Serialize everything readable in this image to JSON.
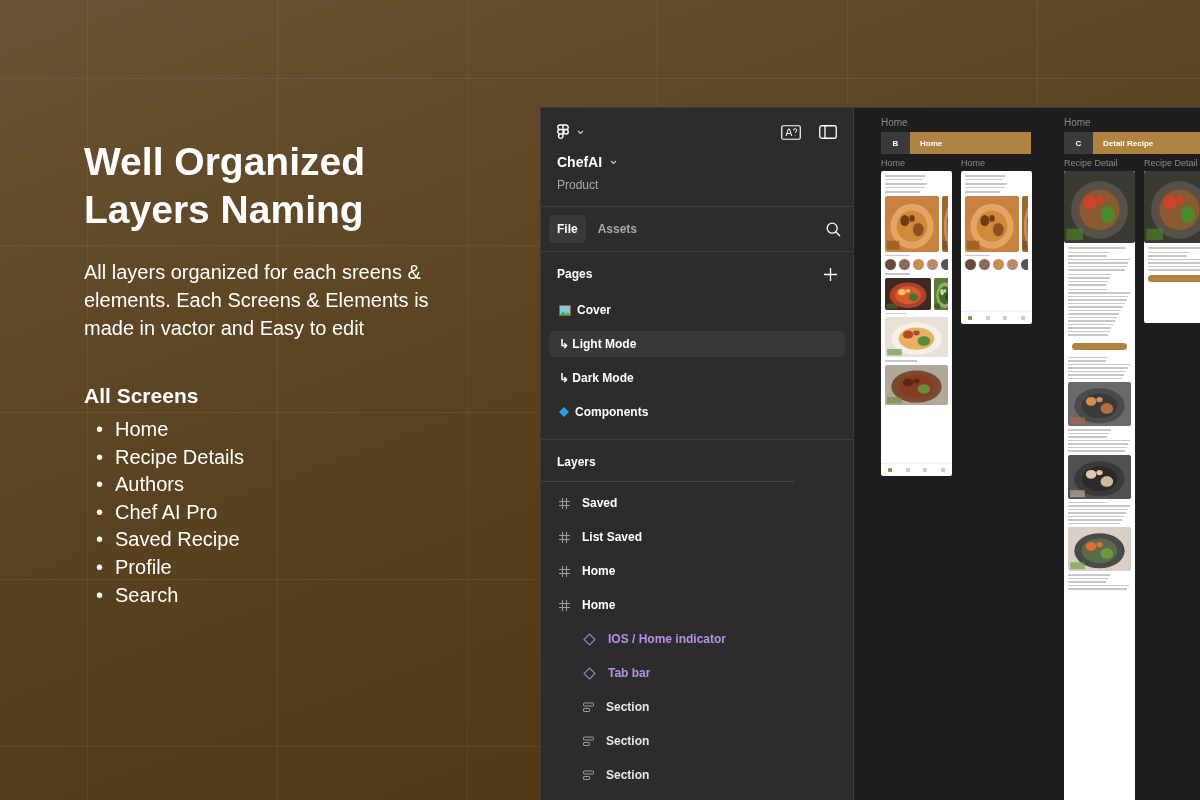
{
  "hero": {
    "title": "Well Organized Layers Naming",
    "description": "All layers organized for each sreens & elements. Each Screens & Elements is made in vactor and Easy to edit",
    "list_title": "All Screens",
    "marker": "•",
    "screens": [
      "Home",
      "Recipe Details",
      "Authors",
      "Chef AI Pro",
      "Saved Recipe",
      "Profile",
      "Search"
    ]
  },
  "sidebar": {
    "file_name": "ChefAI",
    "team": "Product",
    "tabs": [
      {
        "label": "File",
        "selected": true
      },
      {
        "label": "Assets",
        "selected": false
      }
    ],
    "pages_title": "Pages",
    "pages": [
      {
        "label": "Cover",
        "kind": "cover",
        "selected": false
      },
      {
        "label": "↳ Light Mode",
        "kind": "sub",
        "selected": true
      },
      {
        "label": "↳ Dark Mode",
        "kind": "sub",
        "selected": false
      },
      {
        "label": "Components",
        "kind": "component",
        "selected": false
      }
    ],
    "layers_title": "Layers",
    "layers": [
      {
        "name": "Saved",
        "kind": "frame"
      },
      {
        "name": "List Saved",
        "kind": "frame"
      },
      {
        "name": "Home",
        "kind": "frame"
      },
      {
        "name": "Home",
        "kind": "frame",
        "children": [
          {
            "name": "IOS / Home indicator",
            "kind": "instance"
          },
          {
            "name": "Tab bar",
            "kind": "instance"
          },
          {
            "name": "Section",
            "kind": "section"
          },
          {
            "name": "Section",
            "kind": "section"
          },
          {
            "name": "Section",
            "kind": "section"
          }
        ]
      }
    ]
  },
  "canvas": {
    "sections": [
      {
        "label": "Home",
        "letter": "B",
        "title": "Home",
        "frames": [
          {
            "label": "Home",
            "kind": "home_long"
          },
          {
            "label": "Home",
            "kind": "home_short"
          }
        ]
      },
      {
        "label": "Home",
        "letter": "C",
        "title": "Detail Recipe",
        "frames": [
          {
            "label": "Recipe Detail",
            "kind": "detail_long"
          },
          {
            "label": "Recipe Detail",
            "kind": "detail_short"
          }
        ]
      }
    ]
  }
}
